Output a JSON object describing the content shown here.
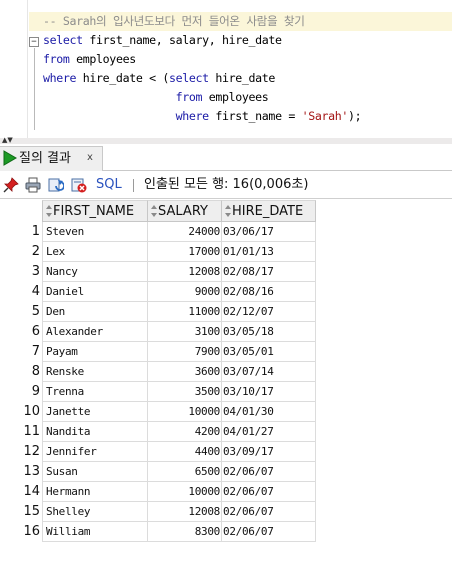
{
  "editor": {
    "lines": [
      [
        {
          "t": "-- Sarah의 입사년도보다 먼저 들어온 사람을 찾기",
          "c": "cm"
        }
      ],
      [
        {
          "t": "select",
          "c": "kw"
        },
        {
          "t": " first_name, salary, hire_date",
          "c": ""
        }
      ],
      [
        {
          "t": "from",
          "c": "kw"
        },
        {
          "t": " employees",
          "c": ""
        }
      ],
      [
        {
          "t": "where",
          "c": "kw"
        },
        {
          "t": " hire_date < (",
          "c": ""
        },
        {
          "t": "select",
          "c": "kw"
        },
        {
          "t": " hire_date",
          "c": ""
        }
      ],
      [
        {
          "t": "                    ",
          "c": ""
        },
        {
          "t": "from",
          "c": "kw"
        },
        {
          "t": " employees",
          "c": ""
        }
      ],
      [
        {
          "t": "                    ",
          "c": ""
        },
        {
          "t": "where",
          "c": "kw"
        },
        {
          "t": " first_name = ",
          "c": ""
        },
        {
          "t": "'Sarah'",
          "c": "st"
        },
        {
          "t": ");",
          "c": ""
        }
      ]
    ],
    "fold_symbol": "−"
  },
  "results_tab": {
    "label": "질의 결과",
    "close": "x"
  },
  "toolbar": {
    "sql_label": "SQL",
    "status": "인출된 모든 행: 16(0,006초)"
  },
  "grid": {
    "columns": [
      "FIRST_NAME",
      "SALARY",
      "HIRE_DATE"
    ],
    "rows": [
      {
        "num": "1",
        "first_name": "Steven",
        "salary": "24000",
        "hire_date": "03/06/17"
      },
      {
        "num": "2",
        "first_name": "Lex",
        "salary": "17000",
        "hire_date": "01/01/13"
      },
      {
        "num": "3",
        "first_name": "Nancy",
        "salary": "12008",
        "hire_date": "02/08/17"
      },
      {
        "num": "4",
        "first_name": "Daniel",
        "salary": "9000",
        "hire_date": "02/08/16"
      },
      {
        "num": "5",
        "first_name": "Den",
        "salary": "11000",
        "hire_date": "02/12/07"
      },
      {
        "num": "6",
        "first_name": "Alexander",
        "salary": "3100",
        "hire_date": "03/05/18"
      },
      {
        "num": "7",
        "first_name": "Payam",
        "salary": "7900",
        "hire_date": "03/05/01"
      },
      {
        "num": "8",
        "first_name": "Renske",
        "salary": "3600",
        "hire_date": "03/07/14"
      },
      {
        "num": "9",
        "first_name": "Trenna",
        "salary": "3500",
        "hire_date": "03/10/17"
      },
      {
        "num": "10",
        "first_name": "Janette",
        "salary": "10000",
        "hire_date": "04/01/30"
      },
      {
        "num": "11",
        "first_name": "Nandita",
        "salary": "4200",
        "hire_date": "04/01/27"
      },
      {
        "num": "12",
        "first_name": "Jennifer",
        "salary": "4400",
        "hire_date": "03/09/17"
      },
      {
        "num": "13",
        "first_name": "Susan",
        "salary": "6500",
        "hire_date": "02/06/07"
      },
      {
        "num": "14",
        "first_name": "Hermann",
        "salary": "10000",
        "hire_date": "02/06/07"
      },
      {
        "num": "15",
        "first_name": "Shelley",
        "salary": "12008",
        "hire_date": "02/06/07"
      },
      {
        "num": "16",
        "first_name": "William",
        "salary": "8300",
        "hire_date": "02/06/07"
      }
    ]
  },
  "icons": {
    "tab": "run-query-triangle-icon",
    "toolbar": [
      "pin-icon",
      "print-icon",
      "refresh-icon",
      "cancel-icon"
    ]
  },
  "colors": {
    "keyword": "#1a1aa6",
    "comment": "#8c8c8c",
    "string": "#a31515",
    "current_line": "#fbf6d9",
    "run_green": "#1d9a26"
  }
}
